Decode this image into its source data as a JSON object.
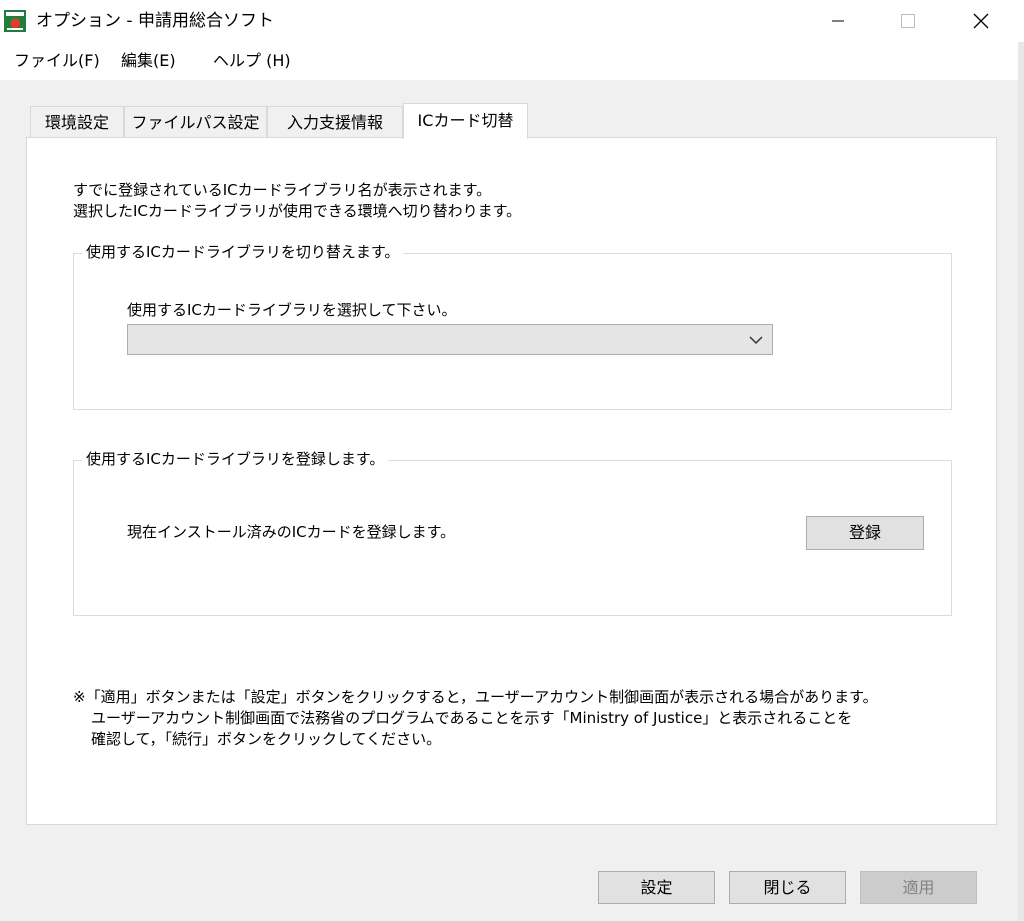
{
  "window": {
    "title": "オプション - 申請用総合ソフト"
  },
  "menu": {
    "items": [
      {
        "label": "ファイル(F)"
      },
      {
        "label": "編集(E)"
      },
      {
        "label": "ヘルプ (H)"
      }
    ]
  },
  "tabs": [
    {
      "label": "環境設定"
    },
    {
      "label": "ファイルパス設定"
    },
    {
      "label": "入力支援情報"
    },
    {
      "label": "ICカード切替"
    }
  ],
  "active_tab": "ICカード切替",
  "panel": {
    "description": [
      "すでに登録されているICカードライブラリ名が表示されます。",
      "選択したICカードライブラリが使用できる環境へ切り替わります。"
    ],
    "switch_group": {
      "legend": "使用するICカードライブラリを切り替えます。",
      "select_label": "使用するICカードライブラリを選択して下さい。",
      "select_value": ""
    },
    "register_group": {
      "legend": "使用するICカードライブラリを登録します。",
      "text": "現在インストール済みのICカードを登録します。",
      "button": "登録"
    },
    "note": [
      "※「適用」ボタンまたは「設定」ボタンをクリックすると，ユーザーアカウント制御画面が表示される場合があります。",
      "ユーザーアカウント制御画面で法務省のプログラムであることを示す「Ministry of Justice」と表示されることを",
      "確認して，「続行」ボタンをクリックしてください。"
    ]
  },
  "footer": {
    "ok_label": "設定",
    "close_label": "閉じる",
    "apply_label": "適用",
    "apply_enabled": false
  },
  "colors": {
    "app_icon_green": "#1e7f3c",
    "app_icon_red": "#d8402b"
  }
}
